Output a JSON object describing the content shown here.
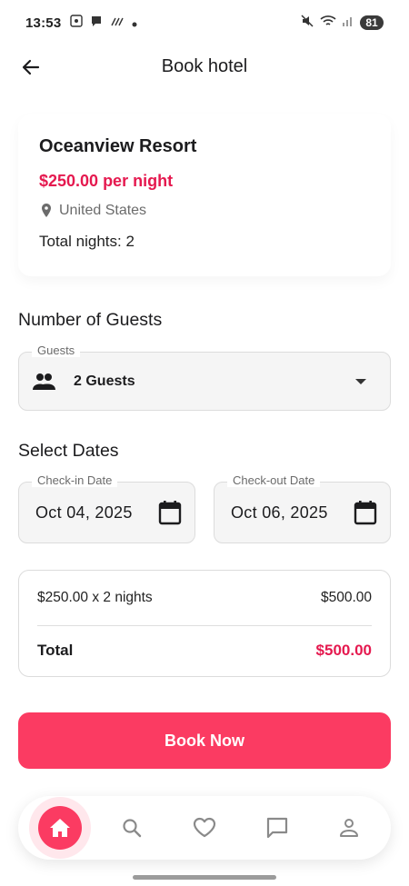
{
  "status_bar": {
    "time": "13:53",
    "battery": "81"
  },
  "app_bar": {
    "title": "Book hotel"
  },
  "hotel": {
    "name": "Oceanview Resort",
    "price": "$250.00 per night",
    "location": "United States",
    "nights_text": "Total nights: 2"
  },
  "guests_section": {
    "title": "Number of Guests",
    "field_label": "Guests",
    "selected_value": "2 Guests"
  },
  "dates_section": {
    "title": "Select Dates",
    "checkin_label": "Check-in Date",
    "checkin_value": "Oct 04, 2025",
    "checkout_label": "Check-out Date",
    "checkout_value": "Oct 06, 2025"
  },
  "summary": {
    "line_label": "$250.00 x 2 nights",
    "line_amount": "$500.00",
    "total_label": "Total",
    "total_amount": "$500.00"
  },
  "book_button": "Book Now",
  "bottom_nav": {
    "items": [
      "home-icon",
      "search-icon",
      "heart-icon",
      "chat-icon",
      "profile-icon"
    ],
    "active": "home"
  },
  "colors": {
    "accent": "#fb3b62",
    "price": "#e5194f"
  }
}
